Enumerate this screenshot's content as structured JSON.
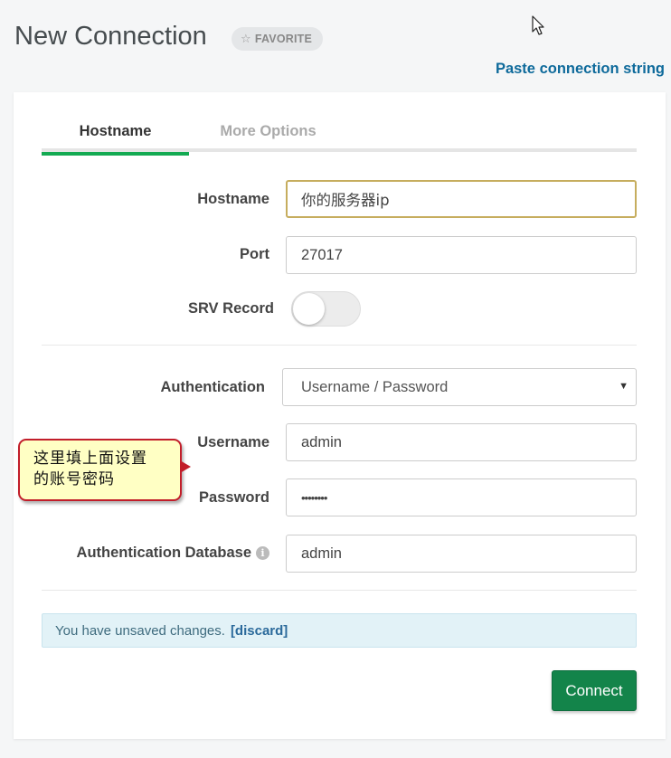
{
  "header": {
    "title": "New Connection",
    "favorite_label": "FAVORITE",
    "favorite_icon": "star-outline-icon",
    "paste_link": "Paste connection string"
  },
  "tabs": [
    {
      "label": "Hostname",
      "active": true
    },
    {
      "label": "More Options",
      "active": false
    }
  ],
  "form": {
    "hostname": {
      "label": "Hostname",
      "value": "你的服务器ip"
    },
    "port": {
      "label": "Port",
      "value": "27017"
    },
    "srv_record": {
      "label": "SRV Record",
      "enabled": false
    },
    "authentication": {
      "label": "Authentication",
      "value": "Username / Password"
    },
    "username": {
      "label": "Username",
      "value": "admin"
    },
    "password": {
      "label": "Password",
      "value": "••••••••"
    },
    "auth_database": {
      "label": "Authentication Database",
      "value": "admin",
      "icon": "info-icon"
    }
  },
  "notice": {
    "text": "You have unsaved changes.",
    "discard": "[discard]"
  },
  "connect_label": "Connect",
  "annotation": {
    "line1": "这里填上面设置",
    "line2": "的账号密码"
  },
  "colors": {
    "accent_green": "#13aa52",
    "connect_green": "#13844a",
    "link_blue": "#0e6a9b",
    "focus_border": "#c6ad5e",
    "callout_border": "#c21e2a",
    "callout_fill": "#ffffc4"
  }
}
